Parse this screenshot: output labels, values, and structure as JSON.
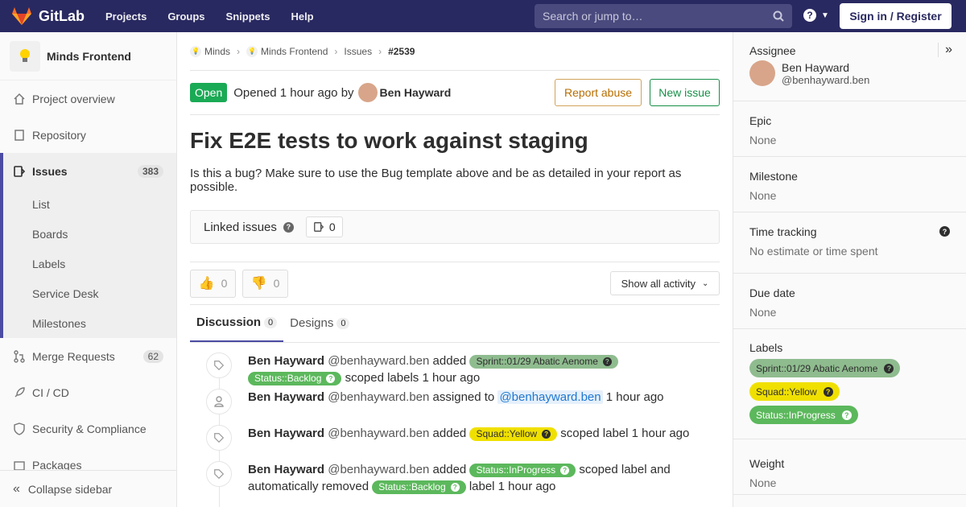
{
  "navbar": {
    "brand": "GitLab",
    "links": [
      "Projects",
      "Groups",
      "Snippets",
      "Help"
    ],
    "search_placeholder": "Search or jump to…",
    "help_glyph": "?",
    "signin": "Sign in / Register",
    "bg_color": "#292961"
  },
  "sidebar": {
    "project_name": "Minds Frontend",
    "items": [
      {
        "label": "Project overview",
        "icon": "home-icon"
      },
      {
        "label": "Repository",
        "icon": "doc-icon"
      },
      {
        "label": "Issues",
        "icon": "issues-icon",
        "count": "383"
      },
      {
        "label": "Merge Requests",
        "icon": "merge-icon",
        "count": "62"
      },
      {
        "label": "CI / CD",
        "icon": "rocket-icon"
      },
      {
        "label": "Security & Compliance",
        "icon": "shield-icon"
      },
      {
        "label": "Packages",
        "icon": "package-icon"
      }
    ],
    "issue_sub": [
      "List",
      "Boards",
      "Labels",
      "Service Desk",
      "Milestones"
    ],
    "collapse": "Collapse sidebar",
    "accent": "#4b4ba3"
  },
  "breadcrumb": {
    "items": [
      "Minds",
      "Minds Frontend",
      "Issues"
    ],
    "current": "#2539"
  },
  "issue": {
    "status": "Open",
    "opened_text": "Opened 1 hour ago by",
    "author": "Ben Hayward",
    "report_abuse": "Report abuse",
    "new_issue": "New issue",
    "title": "Fix E2E tests to work against staging",
    "description": "Is this a bug? Make sure to use the Bug template above and be as detailed in your report as possible.",
    "linked_label": "Linked issues",
    "linked_count": "0",
    "thumbs_up": "0",
    "thumbs_down": "0",
    "activity_filter": "Show all activity",
    "tabs": [
      {
        "label": "Discussion",
        "count": "0"
      },
      {
        "label": "Designs",
        "count": "0"
      }
    ]
  },
  "notes": [
    {
      "who": "Ben Hayward",
      "handle": "@benhayward.ben",
      "verb": "added",
      "labels": [
        "Sprint::01/29 Abatic Aenome",
        "Status::Backlog"
      ],
      "suffix": "scoped labels 1 hour ago"
    },
    {
      "who": "Ben Hayward",
      "handle": "@benhayward.ben",
      "verb": "assigned to",
      "mention": "@benhayward.ben",
      "suffix": "1 hour ago"
    },
    {
      "who": "Ben Hayward",
      "handle": "@benhayward.ben",
      "verb": "added",
      "labels": [
        "Squad::Yellow"
      ],
      "suffix": "scoped label 1 hour ago"
    },
    {
      "who": "Ben Hayward",
      "handle": "@benhayward.ben",
      "verb": "added",
      "labels": [
        "Status::InProgress"
      ],
      "suffix": "scoped label and",
      "line2_prefix": "automatically removed",
      "line2_label": "Status::Backlog",
      "line2_suffix": "label 1 hour ago"
    }
  ],
  "right_sidebar": {
    "assignee_title": "Assignee",
    "assignee_name": "Ben Hayward",
    "assignee_handle": "@benhayward.ben",
    "epic_title": "Epic",
    "epic_value": "None",
    "milestone_title": "Milestone",
    "milestone_value": "None",
    "time_title": "Time tracking",
    "time_value": "No estimate or time spent",
    "due_title": "Due date",
    "due_value": "None",
    "labels_title": "Labels",
    "labels": [
      "Sprint::01/29 Abatic Aenome",
      "Squad::Yellow",
      "Status::InProgress"
    ],
    "weight_title": "Weight",
    "weight_value": "None"
  }
}
